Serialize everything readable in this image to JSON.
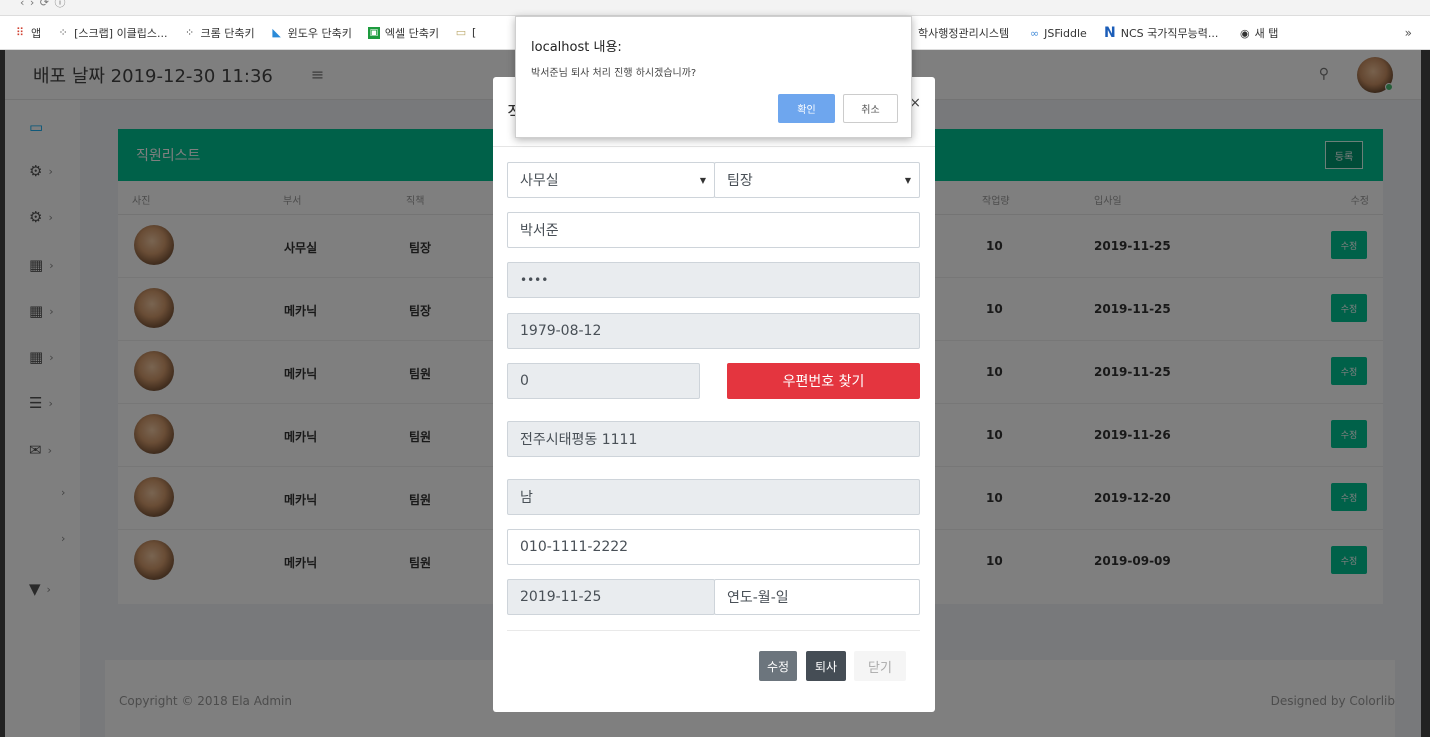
{
  "browser": {
    "bookmarks": [
      {
        "icon": "apps-icon",
        "label": "앱"
      },
      {
        "icon": "tistory-icon",
        "label": "[스크랩] 이클립스..."
      },
      {
        "icon": "tistory-icon",
        "label": "크롬 단축키"
      },
      {
        "icon": "feather-icon",
        "label": "윈도우 단축키"
      },
      {
        "icon": "excel-icon",
        "label": "엑셀 단축키"
      },
      {
        "icon": "folder-icon",
        "label": "["
      }
    ],
    "bookmarks_right": [
      {
        "icon": "",
        "label": "학사행정관리시스템"
      },
      {
        "icon": "jsfiddle-icon",
        "label": "JSFiddle"
      },
      {
        "icon": "ncs-icon",
        "label": "NCS 국가직무능력..."
      },
      {
        "icon": "globe-icon",
        "label": "새 탭"
      }
    ],
    "more": "»"
  },
  "header": {
    "deploy_date": "배포 날짜 2019-12-30 11:36",
    "menu_icon": "≡",
    "search_icon": "⚲"
  },
  "sidebar": {
    "items": [
      {
        "icon": "laptop-icon",
        "glyph": "▭",
        "arrow": ""
      },
      {
        "icon": "cogs-icon",
        "glyph": "⚙",
        "arrow": "›"
      },
      {
        "icon": "cogs-icon",
        "glyph": "⚙",
        "arrow": "›"
      },
      {
        "icon": "table-icon",
        "glyph": "▦",
        "arrow": "›"
      },
      {
        "icon": "grid-icon",
        "glyph": "▦",
        "arrow": "›"
      },
      {
        "icon": "grid-icon",
        "glyph": "▦",
        "arrow": "›"
      },
      {
        "icon": "list-icon",
        "glyph": "☰",
        "arrow": "›"
      },
      {
        "icon": "envelope-icon",
        "glyph": "✉",
        "arrow": "›"
      },
      {
        "icon": "",
        "glyph": "",
        "arrow": "›"
      },
      {
        "icon": "",
        "glyph": "",
        "arrow": "›"
      },
      {
        "icon": "filter-icon",
        "glyph": "▼",
        "arrow": "›"
      }
    ]
  },
  "panel": {
    "title": "직원리스트",
    "add_button": "등록",
    "columns": [
      "사진",
      "부서",
      "직책",
      "작업량",
      "입사일",
      "수정"
    ],
    "rows": [
      {
        "dept": "사무실",
        "position": "팀장",
        "workload": "10",
        "joined": "2019-11-25",
        "edit": "수정"
      },
      {
        "dept": "메카닉",
        "position": "팀장",
        "workload": "10",
        "joined": "2019-11-25",
        "edit": "수정"
      },
      {
        "dept": "메카닉",
        "position": "팀원",
        "workload": "10",
        "joined": "2019-11-25",
        "edit": "수정"
      },
      {
        "dept": "메카닉",
        "position": "팀원",
        "workload": "10",
        "joined": "2019-11-26",
        "edit": "수정"
      },
      {
        "dept": "메카닉",
        "position": "팀원",
        "workload": "10",
        "joined": "2019-12-20",
        "edit": "수정"
      },
      {
        "dept": "메카닉",
        "position": "팀원",
        "workload": "10",
        "joined": "2019-09-09",
        "edit": "수정"
      }
    ]
  },
  "footer": {
    "copyright": "Copyright © 2018 Ela Admin",
    "designed": "Designed by Colorlib"
  },
  "modal": {
    "title_fragment": "직",
    "close_x": "×",
    "department": "사무실",
    "position": "팀장",
    "name": "박서준",
    "password": "••••",
    "birth": "1979-08-12",
    "zipcode": "0",
    "zip_button": "우편번호 찾기",
    "address": "전주시태평동 1111",
    "gender": "남",
    "phone": "010-1111-2222",
    "join_date": "2019-11-25",
    "leave_date_placeholder": "연도-월-일",
    "btn_edit": "수정",
    "btn_retire": "퇴사",
    "btn_close": "닫기"
  },
  "alert": {
    "title": "localhost 내용:",
    "message": "박서준님 퇴사 처리 진행 하시겠습니까?",
    "ok": "확인",
    "cancel": "취소"
  },
  "colors": {
    "accent_green": "#00c292",
    "danger_red": "#e4353f",
    "alert_blue": "#6ea6ee"
  }
}
